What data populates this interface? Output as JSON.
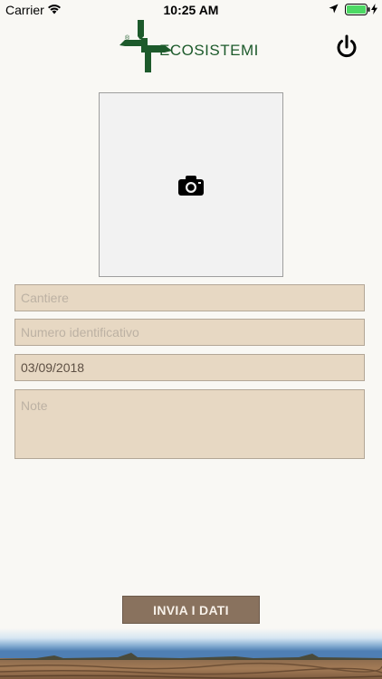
{
  "status_bar": {
    "carrier": "Carrier",
    "time": "10:25 AM",
    "icons": [
      "wifi-icon",
      "location-icon",
      "battery-icon",
      "charging-icon"
    ],
    "battery_color": "#4cd964"
  },
  "header": {
    "logo_text": "ECOSISTEMI",
    "logo_color": "#1d5a2b",
    "power_icon": "power-icon"
  },
  "photo": {
    "icon": "camera-icon"
  },
  "form": {
    "cantiere_placeholder": "Cantiere",
    "numero_placeholder": "Numero identificativo",
    "date_value": "03/09/2018",
    "note_placeholder": "Note"
  },
  "submit": {
    "label": "INVIA I DATI"
  },
  "colors": {
    "background": "#f9f8f4",
    "field_fill": "#e7d8c3",
    "field_border": "#b3a797",
    "button_fill": "#89725e"
  }
}
